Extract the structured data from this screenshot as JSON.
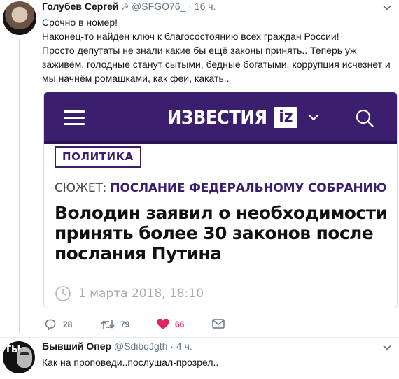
{
  "tweet1": {
    "name": "Голубев Сергей",
    "handle": "@SFGO76_",
    "time": "16 ч.",
    "text_lines": [
      "Срочно в номер!",
      "Наконец-то найден ключ к благосостоянию всех граждан России!",
      "Просто депутаты не знали какие бы ещё законы принять.. Теперь уж заживём, голодные станут сытыми, бедные богатыми, коррупция исчезнет и мы начнём ромашками, как феи, какать.."
    ],
    "card": {
      "logo": "ИЗВЕСТИЯ",
      "logo_badge": "iz",
      "rubric": "ПОЛИТИКА",
      "story_label": "СЮЖЕТ:",
      "story_link": "ПОСЛАНИЕ ФЕДЕРАЛЬНОМУ СОБРАНИЮ",
      "headline": "Володин заявил о необходимости принять более 30 законов после послания Путина",
      "date": "1 марта 2018, 18:10"
    },
    "actions": {
      "replies": "28",
      "retweets": "79",
      "likes": "66"
    }
  },
  "tweet2": {
    "name": "Бывший Опер",
    "handle": "@SdibqJgth",
    "time": "4 ч.",
    "text": "Как на проповеди..послушал-прозрел..",
    "avatar_text": "ТЫ"
  },
  "colors": {
    "brand_purple": "#3b1e6e",
    "like_red": "#e0245e",
    "muted": "#657786"
  },
  "icons": [
    "caret-down-icon",
    "hamburger-icon",
    "search-icon",
    "clock-icon",
    "reply-icon",
    "retweet-icon",
    "heart-icon",
    "envelope-icon"
  ]
}
